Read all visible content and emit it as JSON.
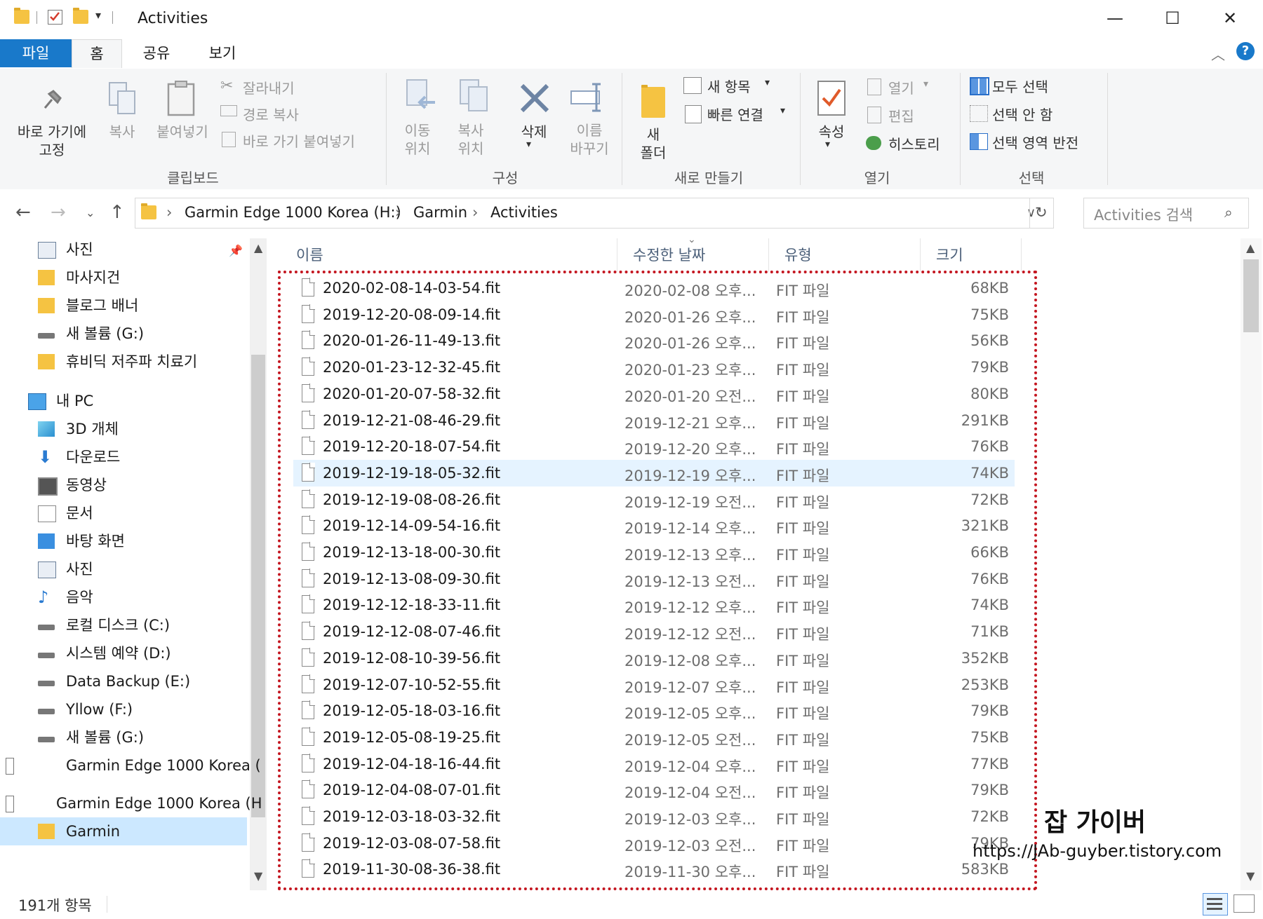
{
  "window": {
    "title": "Activities"
  },
  "ribbon_tabs": {
    "file": "파일",
    "home": "홈",
    "share": "공유",
    "view": "보기"
  },
  "ribbon": {
    "pin_line1": "바로 가기에",
    "pin_line2": "고정",
    "copy": "복사",
    "paste": "붙여넣기",
    "cut": "잘라내기",
    "copy_path": "경로 복사",
    "paste_shortcut": "바로 가기 붙여넣기",
    "group_clipboard": "클립보드",
    "move_line1": "이동",
    "move_line2": "위치",
    "copyto_line1": "복사",
    "copyto_line2": "위치",
    "delete": "삭제",
    "rename_line1": "이름",
    "rename_line2": "바꾸기",
    "group_organize": "구성",
    "newfolder_line1": "새",
    "newfolder_line2": "폴더",
    "new_item": "새 항목",
    "easy_access": "빠른 연결",
    "group_new": "새로 만들기",
    "properties": "속성",
    "open": "열기",
    "edit": "편집",
    "history": "히스토리",
    "group_open": "열기",
    "select_all": "모두 선택",
    "select_none": "선택 안 함",
    "invert_selection": "선택 영역 반전",
    "group_select": "선택"
  },
  "address": {
    "crumbs": [
      "Garmin Edge 1000 Korea (H:)",
      "Garmin",
      "Activities"
    ],
    "search_placeholder": "Activities 검색"
  },
  "nav": {
    "items": [
      {
        "label": "사진",
        "icon": "pictures-icon"
      },
      {
        "label": "마사지건",
        "icon": "folder-icon"
      },
      {
        "label": "블로그 배너",
        "icon": "folder-icon"
      },
      {
        "label": "새 볼륨 (G:)",
        "icon": "drive-icon"
      },
      {
        "label": "휴비딕 저주파 치료기",
        "icon": "folder-icon"
      },
      {
        "label": "내 PC",
        "icon": "pc-icon"
      },
      {
        "label": "3D 개체",
        "icon": "cube-icon"
      },
      {
        "label": "다운로드",
        "icon": "download-icon"
      },
      {
        "label": "동영상",
        "icon": "video-icon"
      },
      {
        "label": "문서",
        "icon": "document-icon"
      },
      {
        "label": "바탕 화면",
        "icon": "desktop-icon"
      },
      {
        "label": "사진",
        "icon": "pictures-icon"
      },
      {
        "label": "음악",
        "icon": "music-icon"
      },
      {
        "label": "로컬 디스크 (C:)",
        "icon": "drive-icon"
      },
      {
        "label": "시스템 예약 (D:)",
        "icon": "drive-icon"
      },
      {
        "label": "Data Backup (E:)",
        "icon": "drive-icon"
      },
      {
        "label": "Yllow (F:)",
        "icon": "drive-icon"
      },
      {
        "label": "새 볼륨 (G:)",
        "icon": "drive-icon"
      },
      {
        "label": "Garmin Edge 1000 Korea (",
        "icon": "device-icon"
      },
      {
        "label": "Garmin Edge 1000 Korea (H",
        "icon": "device-icon"
      },
      {
        "label": "Garmin",
        "icon": "folder-icon"
      }
    ]
  },
  "columns": {
    "name": "이름",
    "date": "수정한 날짜",
    "type": "유형",
    "size": "크기"
  },
  "files": [
    {
      "name": "2020-02-08-14-03-54.fit",
      "date": "2020-02-08 오후...",
      "type": "FIT 파일",
      "size": "68KB"
    },
    {
      "name": "2019-12-20-08-09-14.fit",
      "date": "2020-01-26 오후...",
      "type": "FIT 파일",
      "size": "75KB"
    },
    {
      "name": "2020-01-26-11-49-13.fit",
      "date": "2020-01-26 오후...",
      "type": "FIT 파일",
      "size": "56KB"
    },
    {
      "name": "2020-01-23-12-32-45.fit",
      "date": "2020-01-23 오후...",
      "type": "FIT 파일",
      "size": "79KB"
    },
    {
      "name": "2020-01-20-07-58-32.fit",
      "date": "2020-01-20 오전...",
      "type": "FIT 파일",
      "size": "80KB"
    },
    {
      "name": "2019-12-21-08-46-29.fit",
      "date": "2019-12-21 오후...",
      "type": "FIT 파일",
      "size": "291KB"
    },
    {
      "name": "2019-12-20-18-07-54.fit",
      "date": "2019-12-20 오후...",
      "type": "FIT 파일",
      "size": "76KB"
    },
    {
      "name": "2019-12-19-18-05-32.fit",
      "date": "2019-12-19 오후...",
      "type": "FIT 파일",
      "size": "74KB"
    },
    {
      "name": "2019-12-19-08-08-26.fit",
      "date": "2019-12-19 오전...",
      "type": "FIT 파일",
      "size": "72KB"
    },
    {
      "name": "2019-12-14-09-54-16.fit",
      "date": "2019-12-14 오후...",
      "type": "FIT 파일",
      "size": "321KB"
    },
    {
      "name": "2019-12-13-18-00-30.fit",
      "date": "2019-12-13 오후...",
      "type": "FIT 파일",
      "size": "66KB"
    },
    {
      "name": "2019-12-13-08-09-30.fit",
      "date": "2019-12-13 오전...",
      "type": "FIT 파일",
      "size": "76KB"
    },
    {
      "name": "2019-12-12-18-33-11.fit",
      "date": "2019-12-12 오후...",
      "type": "FIT 파일",
      "size": "74KB"
    },
    {
      "name": "2019-12-12-08-07-46.fit",
      "date": "2019-12-12 오전...",
      "type": "FIT 파일",
      "size": "71KB"
    },
    {
      "name": "2019-12-08-10-39-56.fit",
      "date": "2019-12-08 오후...",
      "type": "FIT 파일",
      "size": "352KB"
    },
    {
      "name": "2019-12-07-10-52-55.fit",
      "date": "2019-12-07 오후...",
      "type": "FIT 파일",
      "size": "253KB"
    },
    {
      "name": "2019-12-05-18-03-16.fit",
      "date": "2019-12-05 오후...",
      "type": "FIT 파일",
      "size": "79KB"
    },
    {
      "name": "2019-12-05-08-19-25.fit",
      "date": "2019-12-05 오전...",
      "type": "FIT 파일",
      "size": "75KB"
    },
    {
      "name": "2019-12-04-18-16-44.fit",
      "date": "2019-12-04 오후...",
      "type": "FIT 파일",
      "size": "77KB"
    },
    {
      "name": "2019-12-04-08-07-01.fit",
      "date": "2019-12-04 오전...",
      "type": "FIT 파일",
      "size": "79KB"
    },
    {
      "name": "2019-12-03-18-03-32.fit",
      "date": "2019-12-03 오후...",
      "type": "FIT 파일",
      "size": "72KB"
    },
    {
      "name": "2019-12-03-08-07-58.fit",
      "date": "2019-12-03 오전...",
      "type": "FIT 파일",
      "size": "79KB"
    },
    {
      "name": "2019-11-30-08-36-38.fit",
      "date": "2019-11-30 오후...",
      "type": "FIT 파일",
      "size": "583KB"
    }
  ],
  "status": {
    "count": "191개 항목"
  },
  "watermark": {
    "title": "잡 가이버",
    "url": "https://JAb-guyber.tistory.com"
  },
  "colors": {
    "accent": "#1979ca",
    "selection": "#e5f3ff",
    "highlight_border": "#c41620"
  }
}
